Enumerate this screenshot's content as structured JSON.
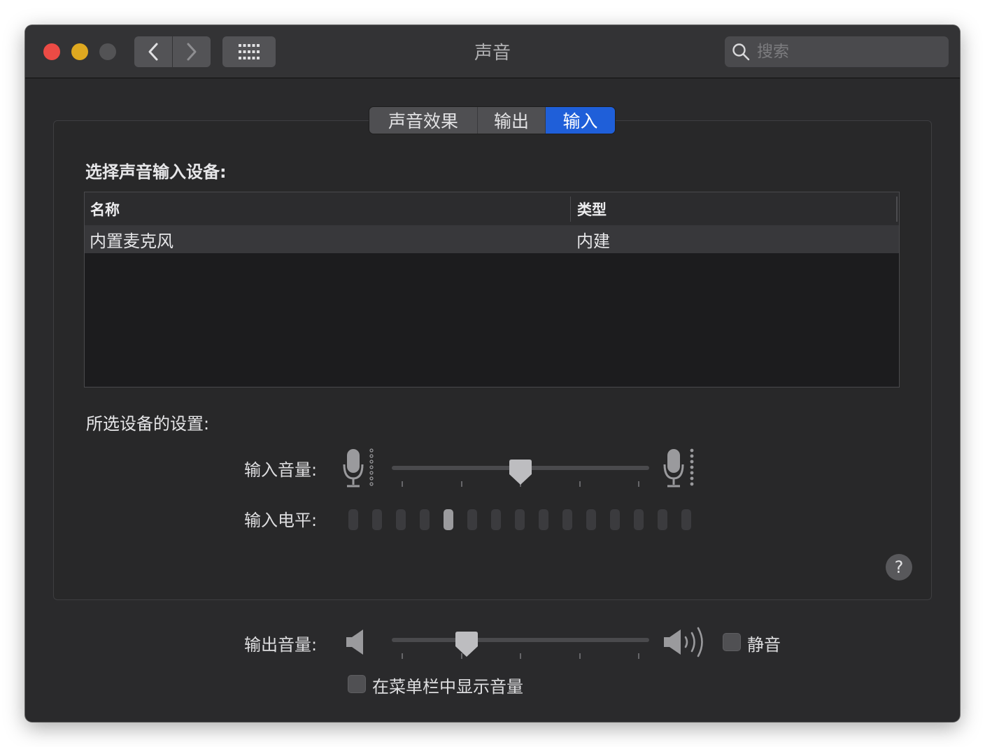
{
  "window": {
    "title": "声音"
  },
  "toolbar": {
    "back_icon": "chevron-left-icon",
    "forward_icon": "chevron-right-icon",
    "show_all_icon": "grid-icon",
    "search_placeholder": "搜索"
  },
  "tabs": [
    {
      "label": "声音效果",
      "active": false
    },
    {
      "label": "输出",
      "active": false
    },
    {
      "label": "输入",
      "active": true
    }
  ],
  "input": {
    "device_heading": "选择声音输入设备:",
    "table": {
      "columns": [
        "名称",
        "类型"
      ],
      "rows": [
        {
          "name": "内置麦克风",
          "type": "内建",
          "selected": true
        }
      ]
    },
    "settings_heading": "所选设备的设置:",
    "input_volume_label": "输入音量:",
    "input_volume": 0.5,
    "input_level_label": "输入电平:",
    "input_level_segments": 15,
    "input_level_active_index": 4
  },
  "output": {
    "output_volume_label": "输出音量:",
    "output_volume": 0.27,
    "mute_label": "静音",
    "mute_checked": false,
    "show_in_menubar_label": "在菜单栏中显示音量",
    "show_in_menubar_checked": false
  },
  "help": {
    "label": "?"
  },
  "colors": {
    "accent": "#1f5fd9",
    "close": "#ec4b45",
    "minimize": "#dfa920",
    "zoom_disabled": "#535355"
  }
}
